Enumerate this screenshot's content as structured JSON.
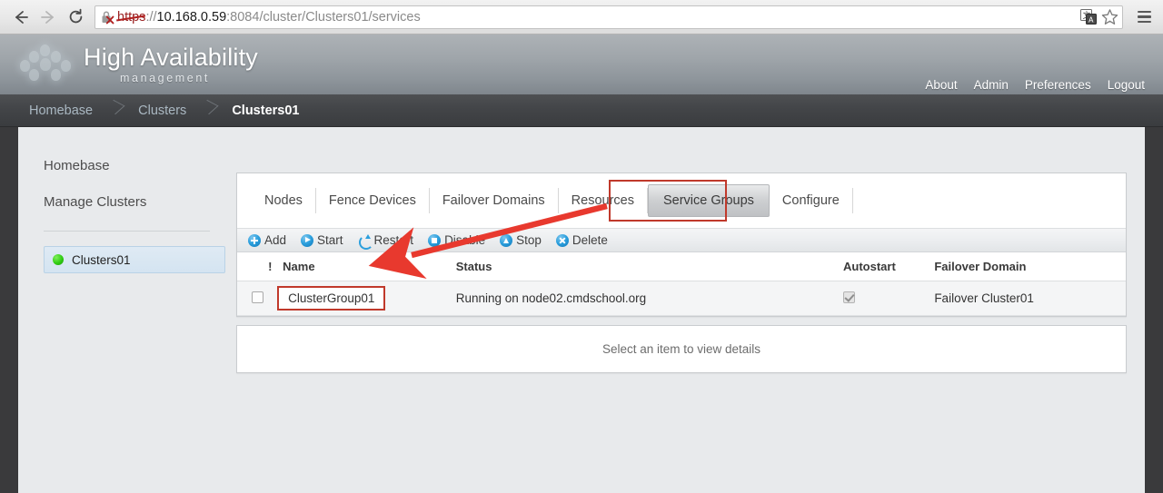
{
  "browser": {
    "back_icon": "back-arrow-icon",
    "forward_icon": "forward-arrow-icon",
    "reload_icon": "reload-icon",
    "security_icon": "insecure-lock-icon",
    "url_scheme": "https",
    "url_sep": "://",
    "url_host": "10.168.0.59",
    "url_port": ":8084",
    "url_path": "/cluster/Clusters01/services",
    "full_url": "https://10.168.0.59:8084/cluster/Clusters01/services",
    "translate_icon": "translate-icon",
    "bookmark_icon": "star-icon",
    "menu_icon": "hamburger-menu-icon"
  },
  "header": {
    "logo_icon": "honeycomb-dots-logo",
    "title": "High Availability",
    "subtitle": "management",
    "links": [
      {
        "label": "About"
      },
      {
        "label": "Admin"
      },
      {
        "label": "Preferences"
      },
      {
        "label": "Logout"
      }
    ]
  },
  "breadcrumb": {
    "items": [
      {
        "label": "Homebase",
        "active": false
      },
      {
        "label": "Clusters",
        "active": false
      },
      {
        "label": "Clusters01",
        "active": true
      }
    ]
  },
  "sidebar": {
    "links": [
      {
        "label": "Homebase"
      },
      {
        "label": "Manage Clusters"
      }
    ],
    "cluster": {
      "status_icon": "green-status-dot",
      "status_color": "#2fcc13",
      "label": "Clusters01"
    }
  },
  "main": {
    "tabs": [
      {
        "label": "Nodes",
        "active": false
      },
      {
        "label": "Fence Devices",
        "active": false
      },
      {
        "label": "Failover Domains",
        "active": false
      },
      {
        "label": "Resources",
        "active": false
      },
      {
        "label": "Service Groups",
        "active": true
      },
      {
        "label": "Configure",
        "active": false
      }
    ],
    "toolbar": [
      {
        "label": "Add",
        "icon": "plus-circle-icon"
      },
      {
        "label": "Start",
        "icon": "play-circle-icon"
      },
      {
        "label": "Restart",
        "icon": "refresh-icon"
      },
      {
        "label": "Disable",
        "icon": "stop-square-circle-icon"
      },
      {
        "label": "Stop",
        "icon": "triangle-up-circle-icon"
      },
      {
        "label": "Delete",
        "icon": "x-circle-icon"
      }
    ],
    "table": {
      "columns": [
        "",
        "!",
        "Name",
        "Status",
        "Autostart",
        "Failover Domain"
      ],
      "rows": [
        {
          "selected": false,
          "alert": "",
          "name": "ClusterGroup01",
          "status": "Running on node02.cmdschool.org",
          "autostart": true,
          "failover_domain": "Failover Cluster01"
        }
      ]
    },
    "details_placeholder": "Select an item to view details"
  },
  "annotations": {
    "highlight_color": "#c0392b",
    "arrow_color": "#e8392e",
    "highlighted_tab": "Service Groups",
    "highlighted_cell": "ClusterGroup01"
  }
}
